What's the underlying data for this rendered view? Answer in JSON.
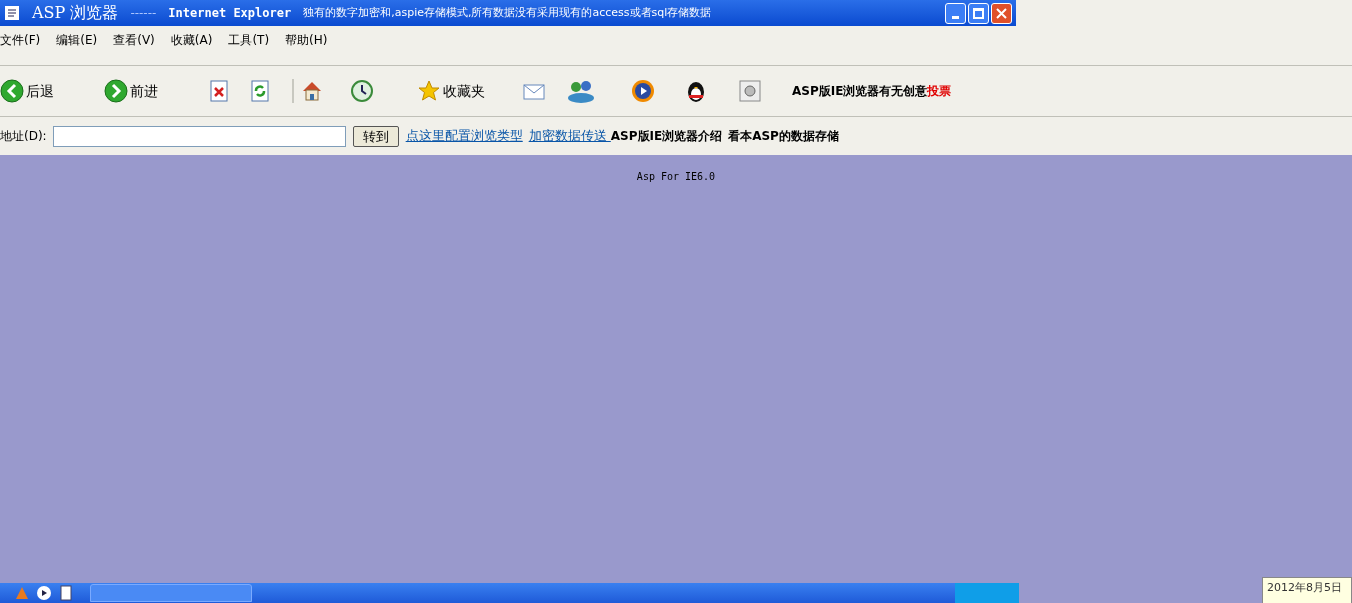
{
  "window": {
    "title": "ASP 浏览器",
    "separator": "------",
    "app": "Internet Explorer",
    "subtitle": "独有的数字加密和,aspie存储模式,所有数据没有采用现有的access或者sql存储数据"
  },
  "menu": [
    "文件(F)",
    "编辑(E)",
    "查看(V)",
    "收藏(A)",
    "工具(T)",
    "帮助(H)"
  ],
  "toolbar": [
    {
      "kind": "back",
      "label": "后退"
    },
    {
      "kind": "forward",
      "label": "前进"
    },
    {
      "kind": "stop"
    },
    {
      "kind": "refresh"
    },
    {
      "kind": "separator"
    },
    {
      "kind": "home"
    },
    {
      "kind": "history"
    },
    {
      "kind": "favorites",
      "label": "收藏夹"
    },
    {
      "kind": "mail"
    },
    {
      "kind": "messenger"
    },
    {
      "kind": "media"
    },
    {
      "kind": "penguin"
    },
    {
      "kind": "square"
    }
  ],
  "poll": {
    "text": "ASP版IE浏览器有无创意",
    "link": "投票"
  },
  "address": {
    "label": "地址(D):",
    "button": "转到"
  },
  "links": [
    {
      "kind": "link",
      "text": "点这里配置浏览类型"
    },
    {
      "kind": "link",
      "text": "加密数据传送 "
    },
    {
      "kind": "bold",
      "text": "ASP版IE浏览器介绍"
    },
    {
      "kind": "bold",
      "text": "看本ASP的数据存储"
    }
  ],
  "content": {
    "text": "Asp For IE6.0"
  },
  "tooltip": {
    "text": "2012年8月5日"
  }
}
